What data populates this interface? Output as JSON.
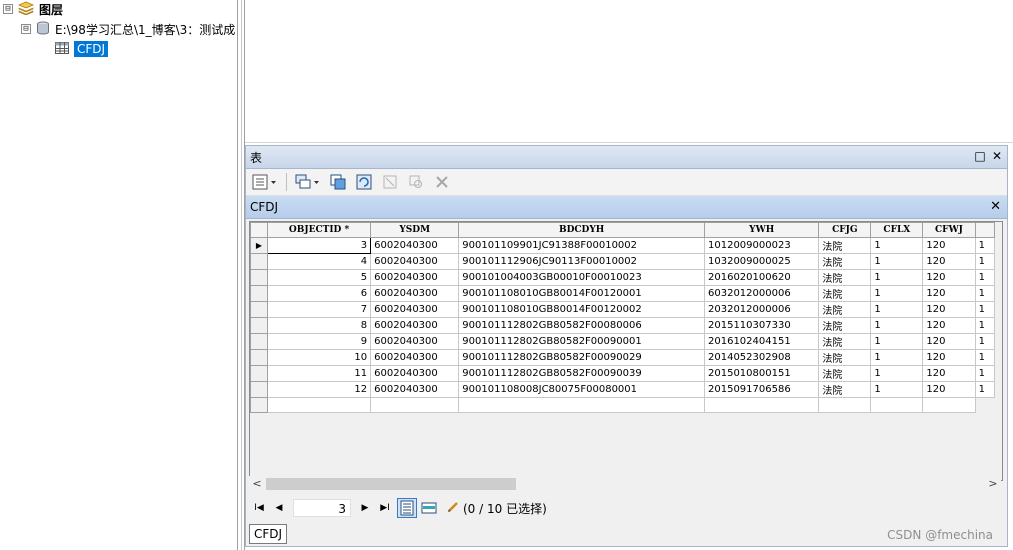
{
  "toc": {
    "root_label": "图层",
    "root_expander": "⊟",
    "db_expander": "⊟",
    "db_label": "E:\\98学习汇总\\1_博客\\3：测试成",
    "table_label": "CFDJ"
  },
  "window": {
    "title": "表",
    "maximize_icon": "□",
    "close_icon": "✕"
  },
  "tab": {
    "name": "CFDJ",
    "close_icon": "✕"
  },
  "grid": {
    "columns": [
      "",
      "OBJECTID *",
      "YSDM",
      "BDCDYH",
      "YWH",
      "CFJG",
      "CFLX",
      "CFWJ",
      ""
    ],
    "rows": [
      [
        "3",
        "6002040300",
        "900101109901JC91388F00010002",
        "1012009000023",
        "法院",
        "1",
        "120",
        "1"
      ],
      [
        "4",
        "6002040300",
        "900101112906JC90113F00010002",
        "1032009000025",
        "法院",
        "1",
        "120",
        "1"
      ],
      [
        "5",
        "6002040300",
        "900101004003GB00010F00010023",
        "2016020100620",
        "法院",
        "1",
        "120",
        "1"
      ],
      [
        "6",
        "6002040300",
        "900101108010GB80014F00120001",
        "6032012000006",
        "法院",
        "1",
        "120",
        "1"
      ],
      [
        "7",
        "6002040300",
        "900101108010GB80014F00120002",
        "2032012000006",
        "法院",
        "1",
        "120",
        "1"
      ],
      [
        "8",
        "6002040300",
        "900101112802GB80582F00080006",
        "2015110307330",
        "法院",
        "1",
        "120",
        "1"
      ],
      [
        "9",
        "6002040300",
        "900101112802GB80582F00090001",
        "2016102404151",
        "法院",
        "1",
        "120",
        "1"
      ],
      [
        "10",
        "6002040300",
        "900101112802GB80582F00090029",
        "2014052302908",
        "法院",
        "1",
        "120",
        "1"
      ],
      [
        "11",
        "6002040300",
        "900101112802GB80582F00090039",
        "2015010800151",
        "法院",
        "1",
        "120",
        "1"
      ],
      [
        "12",
        "6002040300",
        "900101108008JC80075F00080001",
        "2015091706586",
        "法院",
        "1",
        "120",
        "1"
      ]
    ],
    "current_row_marker": "▶"
  },
  "scrollbar": {
    "left_arrow": "<",
    "right_arrow": ">"
  },
  "nav": {
    "first": "I◀",
    "prev": "◀",
    "current_record": "3",
    "next": "▶",
    "last": "▶I",
    "selection_status": "(0 / 10 已选择)"
  },
  "bottom_tab": "CFDJ",
  "watermark": "CSDN @fmechina"
}
